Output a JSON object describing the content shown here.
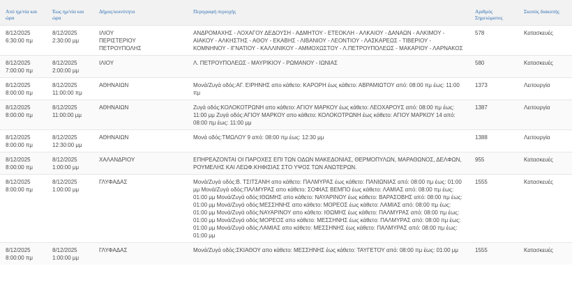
{
  "table": {
    "headers": {
      "from": "Από ημ/νία και ώρα",
      "to": "Έως ημ/νία και ώρα",
      "municipality": "Δήμος/κοινότητα",
      "area_desc": "Περιγραφή περιοχής",
      "points": "Αριθμός Σημειώματος",
      "purpose": "Σκοπός διακοπής"
    },
    "rows": [
      {
        "from_date": "8/12/2025",
        "from_time": "6:30:00 πμ",
        "to_date": "8/12/2025",
        "to_time": "2:30:00 μμ",
        "municipality": "ΙΛΙΟΥ\nΠΕΡΙΣΤΕΡΙΟΥ\nΠΕΤΡΟΥΠΟΛΗΣ",
        "area": "ΑΝΔΡΟΜΑΧΗΣ - ΛΟΧΑΓΟΥ ΔΕΔΟΥΣΗ - ΑΔΜΗΤΟΥ - ΕΤΕΟΚΛΗ - ΑΛΚΑΙΟΥ - ΔΑΝΑΩΝ - ΑΛΚΙΜΟΥ - ΑΙΑΚΟΥ - ΑΛΚΗΣΤΗΣ - ΑΘΟΥ - ΕΚΑΒΗΣ - ΛΙΒΑΝΙΟΥ - ΛΕΟΝΤΙΟΥ - ΛΑΣΚΑΡΕΩΣ - ΤΙΒΕΡΙΟΥ - ΚΟΜΝΗΝΟΥ - ΙΓΝΑΤΙΟΥ - ΚΑΛΛΙΝΙΚΟΥ - ΑΜΜΟΧΩΣΤΟΥ - Λ.ΠΕΤΡΟΥΠΟΛΕΩΣ - ΜΑΚΑΡΙΟΥ - ΛΑΡΝΑΚΟΣ",
        "points": "578",
        "purpose": "Κατασκευές"
      },
      {
        "from_date": "8/12/2025",
        "from_time": "7:00:00 πμ",
        "to_date": "8/12/2025",
        "to_time": "2:00:00 μμ",
        "municipality": "ΙΛΙΟΥ",
        "area": "Λ. ΠΕΤΡΟΥΠΟΛΕΩΣ - ΜΑΥΡΙΚΙΟΥ - ΡΩΜΑΝΟΥ - ΙΩΝΙΑΣ",
        "points": "580",
        "purpose": "Κατασκευές"
      },
      {
        "from_date": "8/12/2025",
        "from_time": "8:00:00 πμ",
        "to_date": "8/12/2025",
        "to_time": "11:00:00 πμ",
        "municipality": "ΑΘΗΝΑΙΩΝ",
        "area": "Μονά/Ζυγά οδός:ΑΓ. ΕΙΡΗΝΗΣ απο κάθετο: ΚΑΡΟΡΗ έως κάθετο: ΑΒΡΑΜΙΩΤΟΥ από: 08:00 πμ έως: 11:00 πμ",
        "points": "1373",
        "purpose": "Λειτουργία"
      },
      {
        "from_date": "8/12/2025",
        "from_time": "8:00:00 πμ",
        "to_date": "8/12/2025",
        "to_time": "11:00:00 μμ",
        "municipality": "ΑΘΗΝΑΙΩΝ",
        "area": "Ζυγά οδός:ΚΟΛΟΚΟΤΡΩΝΗ απο κάθετο: ΑΓΙΟΥ ΜΑΡΚΟΥ έως κάθετο: ΛΕΟΧΑΡΟΥΣ από: 08:00 πμ έως: 11:00 μμ Ζυγά οδός:ΑΓΙΟΥ ΜΑΡΚΟΥ απο κάθετο: ΚΟΛΟΚΟΤΡΩΝΗ έως κάθετο: ΑΓΙΟΥ ΜΑΡΚΟΥ 14 από: 08:00 πμ έως: 11:00 μμ",
        "points": "1387",
        "purpose": "Λειτουργία"
      },
      {
        "from_date": "8/12/2025",
        "from_time": "8:00:00 πμ",
        "to_date": "8/12/2025",
        "to_time": "12:30:00 μμ",
        "municipality": "ΑΘΗΝΑΙΩΝ",
        "area": "Μονά οδός:ΤΜΩΛΟΥ 9 από: 08:00 πμ έως: 12:30 μμ",
        "points": "1388",
        "purpose": "Λειτουργία"
      },
      {
        "from_date": "8/12/2025",
        "from_time": "8:00:00 πμ",
        "to_date": "8/12/2025",
        "to_time": "1:00:00 μμ",
        "municipality": "ΧΑΛΑΝΔΡΙΟΥ",
        "area": "ΕΠΗΡΕΑΖΟΝΤΑΙ ΟΙ ΠΑΡΟΧΕΣ ΕΠΙ ΤΩΝ ΟΔΩΝ ΜΑΚΕΔΟΝΙΑΣ, ΘΕΡΜΟΠΥΛΩΝ, ΜΑΡΑΘΩΝΟΣ, ΔΕΛΦΩΝ, ΡΟΥΜΕΛΗΣ ΚΑΙ ΛΕΩΦ.ΚΗΦΙΣΙΑΣ ΣΤΟ ΥΨΟΣ ΤΩΝ ΑΝΩΤΕΡΩΝ.",
        "points": "955",
        "purpose": "Κατασκευές"
      },
      {
        "from_date": "8/12/2025",
        "from_time": "8:00:00 πμ",
        "to_date": "8/12/2025",
        "to_time": "1:00:00 μμ",
        "municipality": "ΓΛΥΦΑΔΑΣ",
        "area": "Μονά/Ζυγά οδός:Β. ΤΣΙΤΣΑΝΗ απο κάθετο: ΠΑΛΜΥΡΑΣ έως κάθετο: ΠΑΝΙΩΝΙΑΣ από: 08:00 πμ έως: 01:00 μμ Μονά/Ζυγά οδός:ΠΑΛΜΥΡΑΣ απο κάθετο: ΣΟΦΙΑΣ ΒΕΜΠΟ έως κάθετο: ΛΑΜΙΑΣ από: 08:00 πμ έως: 01:00 μμ Μονά/Ζυγά οδός:ΙΘΩΜΗΣ απο κάθετο: ΝΑΥΑΡΙΝΟΥ έως κάθετο: ΒΑΡΑΣΟΒΗΣ από: 08:00 πμ έως: 01:00 μμ Μονά/Ζυγά οδός:ΜΕΣΣΗΝΗΣ απο κάθετο: ΜΟΡΕΟΣ έως κάθετο: ΛΑΜΙΑΣ από: 08:00 πμ έως: 01:00 μμ Μονά/Ζυγά οδός:ΝΑΥΑΡΙΝΟΥ απο κάθετο: ΙΘΩΜΗΣ έως κάθετο: ΠΑΛΜΥΡΑΣ από: 08:00 πμ έως: 01:00 μμ Μονά/Ζυγά οδός:ΜΟΡΕΟΣ απο κάθετο: ΜΕΣΣΗΝΗΣ έως κάθετο: ΠΑΛΜΥΡΑΣ από: 08:00 πμ έως: 01:00 μμ Μονά/Ζυγά οδός:ΛΑΜΙΑΣ απο κάθετο: ΜΕΣΣΗΝΗΣ έως κάθετο: ΠΑΛΜΥΡΑΣ από: 08:00 πμ έως: 01:00 μμ",
        "points": "1555",
        "purpose": "Κατασκευές"
      },
      {
        "from_date": "8/12/2025",
        "from_time": "8:00:00 πμ",
        "to_date": "8/12/2025",
        "to_time": "1:00:00 μμ",
        "municipality": "ΓΛΥΦΑΔΑΣ",
        "area": "Μονά/Ζυγά οδός:ΣΚΙΑΘΟΥ απο κάθετο: ΜΕΣΣΗΝΗΣ έως κάθετο: ΤΑΥΓΕΤΟΥ από: 08:00 πμ έως: 01:00 μμ",
        "points": "1555",
        "purpose": "Κατασκευές"
      }
    ]
  }
}
